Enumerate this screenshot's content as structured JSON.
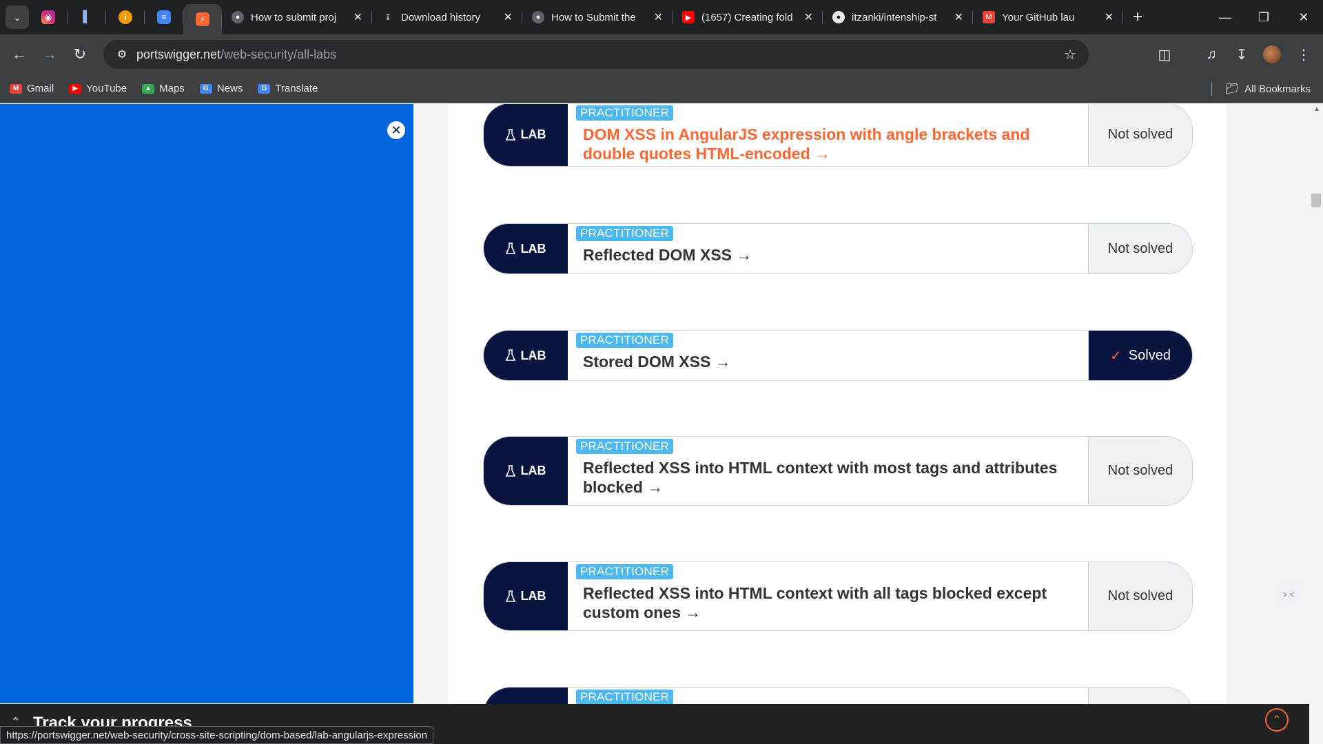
{
  "browser": {
    "tabs": [
      {
        "title": "How to submit proj",
        "icon": "globe-icon"
      },
      {
        "title": "Download history",
        "icon": "download-icon"
      },
      {
        "title": "How to Submit the",
        "icon": "globe-icon"
      },
      {
        "title": "(1657) Creating fold",
        "icon": "youtube-icon"
      },
      {
        "title": "itzanki/intenship-st",
        "icon": "github-icon"
      },
      {
        "title": "Your GitHub lau",
        "icon": "gmail-icon"
      }
    ],
    "url_host": "portswigger.net",
    "url_path": "/web-security/all-labs",
    "bookmarks": [
      "Gmail",
      "YouTube",
      "Maps",
      "News",
      "Translate"
    ],
    "all_bookmarks_label": "All Bookmarks",
    "status_url": "https://portswigger.net/web-security/cross-site-scripting/dom-based/lab-angularjs-expression"
  },
  "page": {
    "badge_label": "LAB",
    "labs": [
      {
        "level": "PRACTITIONER",
        "title": "DOM XSS in AngularJS expression with angle brackets and double quotes HTML-encoded →",
        "status": "Not solved"
      },
      {
        "level": "PRACTITIONER",
        "title": "Reflected DOM XSS →",
        "status": "Not solved"
      },
      {
        "level": "PRACTITIONER",
        "title": "Stored DOM XSS →",
        "status": "Solved"
      },
      {
        "level": "PRACTITIONER",
        "title": "Reflected XSS into HTML context with most tags and attributes blocked →",
        "status": "Not solved"
      },
      {
        "level": "PRACTITIONER",
        "title": "Reflected XSS into HTML context with all tags blocked except custom ones →",
        "status": "Not solved"
      },
      {
        "level": "PRACTITIONER",
        "title": "",
        "status": ""
      }
    ],
    "track_progress_label": "Track your progress"
  },
  "colors": {
    "navy": "#0a1440",
    "orange": "#ff6633",
    "practitioner_blue": "#4db8f0",
    "panel_blue": "#0066dd"
  }
}
